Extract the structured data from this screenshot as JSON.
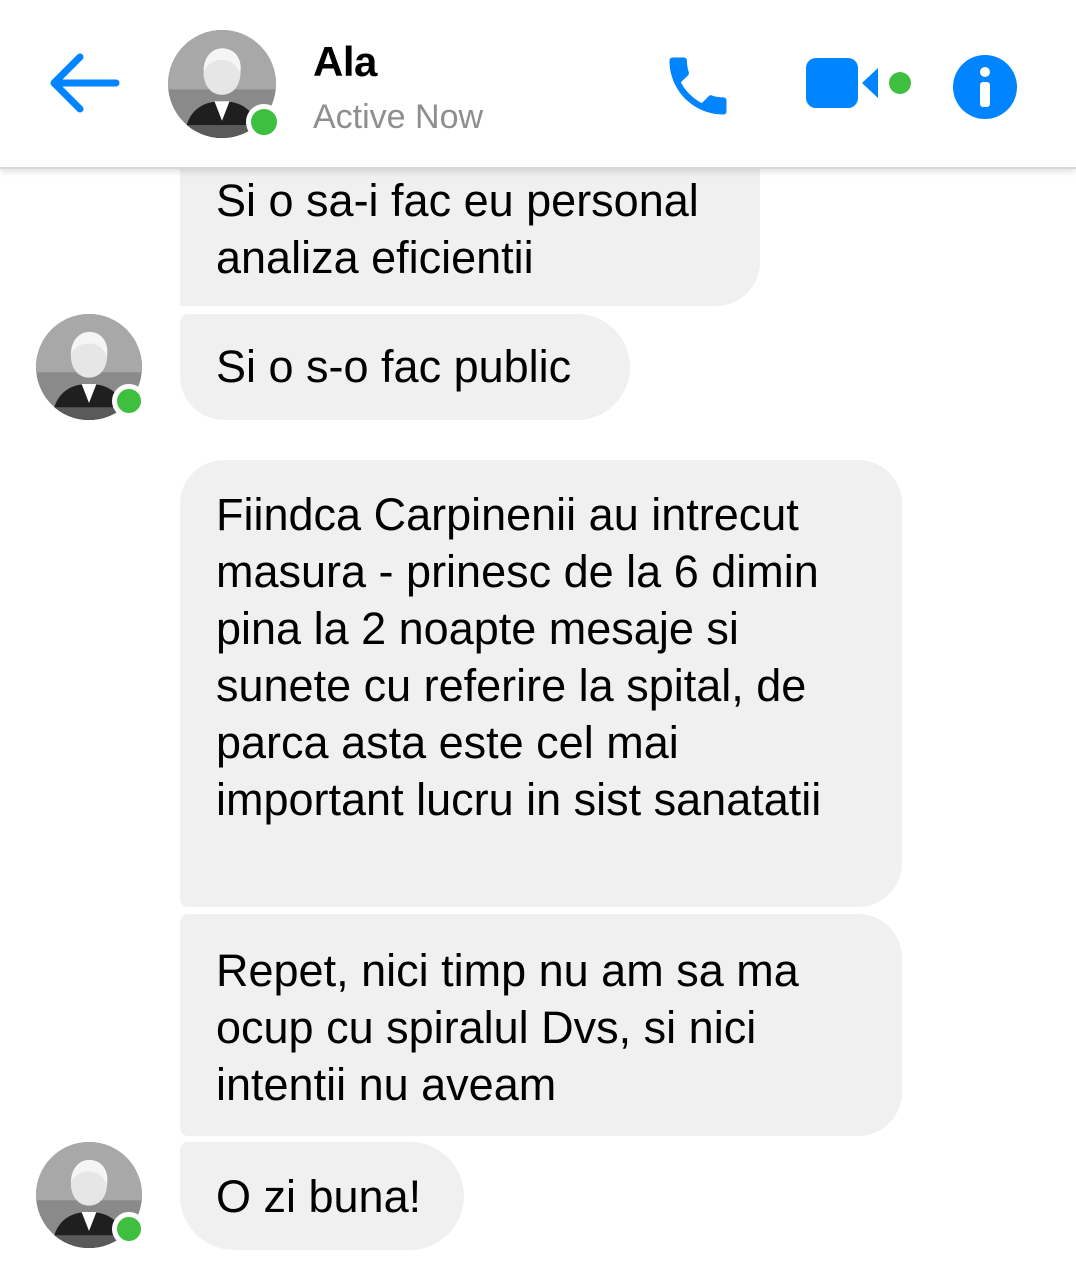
{
  "header": {
    "contact_name": "Ala",
    "status": "Active Now",
    "accent_color": "#0084ff",
    "online_color": "#3fbf3f",
    "icons": [
      "back-arrow-icon",
      "phone-icon",
      "video-camera-icon",
      "info-icon"
    ]
  },
  "messages": [
    {
      "id": 1,
      "text": "Si o sa-i fac eu personal analiza eficientii"
    },
    {
      "id": 2,
      "text": "Si o s-o fac public"
    },
    {
      "id": 3,
      "text": "Fiindca Carpinenii au intrecut masura - prinesc de la 6 dimin pina la 2 noapte mesaje si sunete cu referire la spital, de parca asta este cel mai important lucru in sist sanatatii"
    },
    {
      "id": 4,
      "text": "Repet, nici timp nu am sa ma ocup cu spiralul Dvs, si nici intentii nu aveam"
    },
    {
      "id": 5,
      "text": "O zi buna!"
    }
  ]
}
